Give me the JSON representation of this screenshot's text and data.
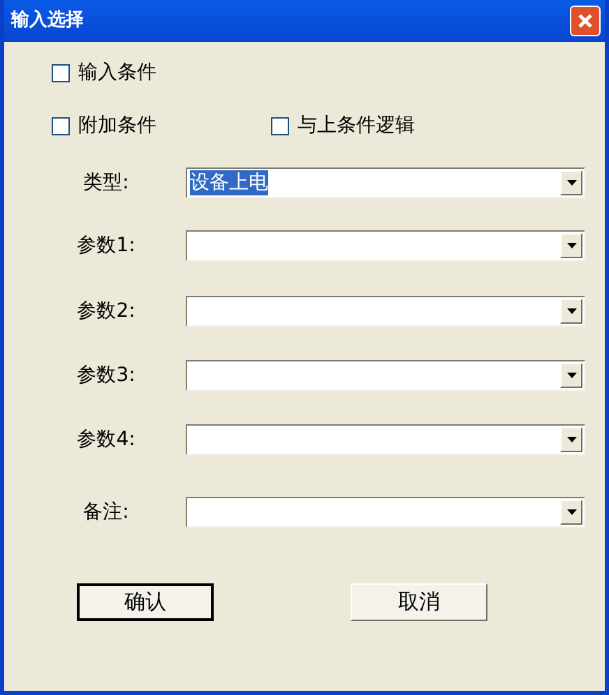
{
  "window": {
    "title": "输入选择"
  },
  "checkboxes": [
    {
      "label": "输入条件",
      "checked": false
    },
    {
      "label": "附加条件",
      "checked": false
    },
    {
      "label": "与上条件逻辑",
      "checked": false
    }
  ],
  "fields": [
    {
      "label": "类型:",
      "value": "设备上电",
      "value_selected": true
    },
    {
      "label": "参数1:"
    },
    {
      "label": "参数2:"
    },
    {
      "label": "参数3:"
    },
    {
      "label": "参数4:"
    },
    {
      "label": "备注:"
    }
  ],
  "buttons": [
    {
      "label": "确认",
      "default": true
    },
    {
      "label": "取消",
      "default": false
    }
  ]
}
